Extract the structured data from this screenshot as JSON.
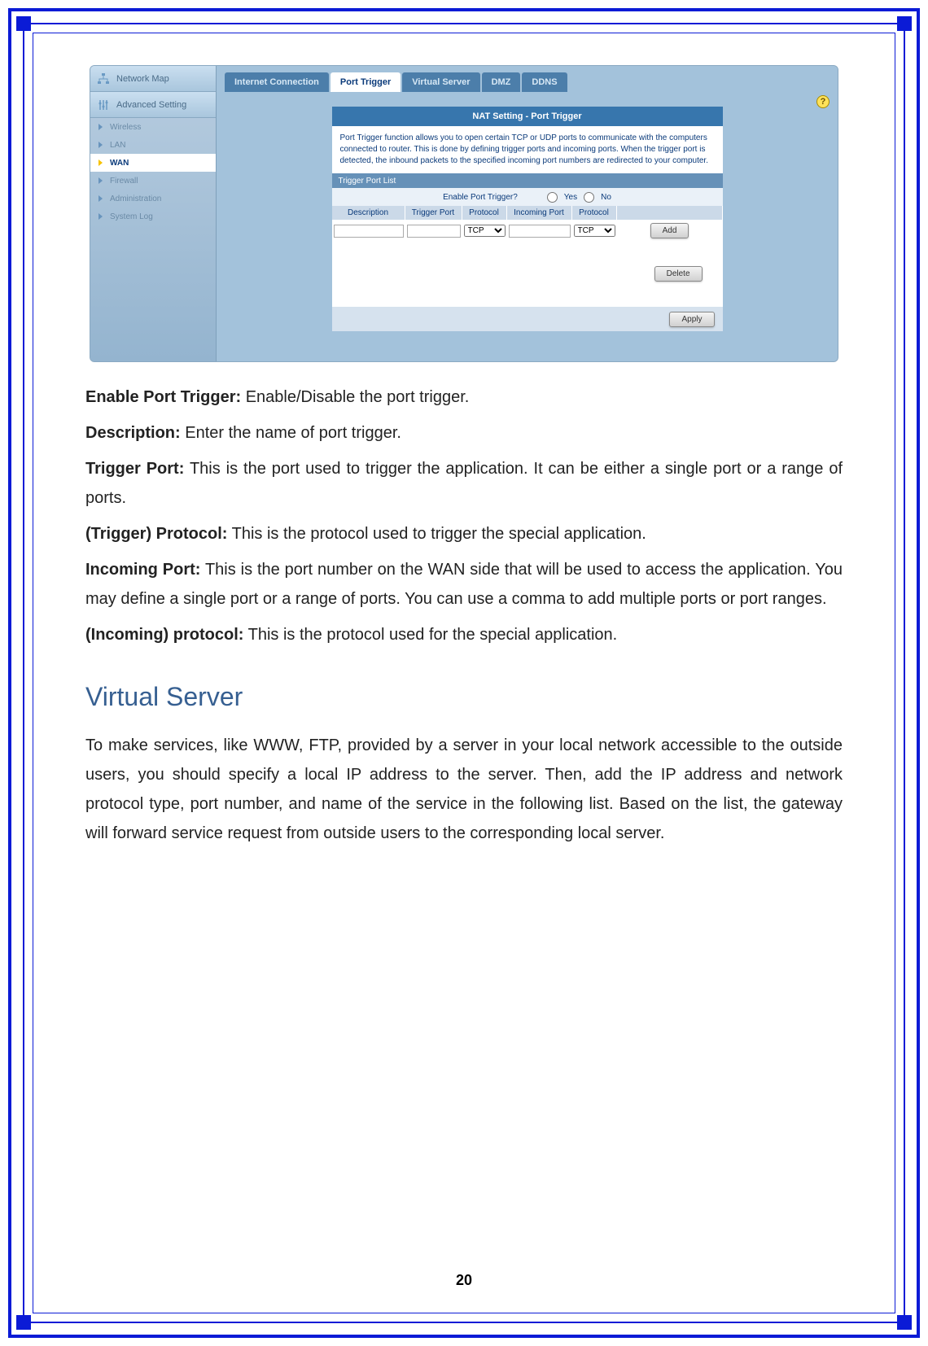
{
  "pageNumber": "20",
  "nav": {
    "networkMap": "Network Map",
    "advancedSetting": "Advanced Setting",
    "items": [
      "Wireless",
      "LAN",
      "WAN",
      "Firewall",
      "Administration",
      "System Log"
    ]
  },
  "tabs": [
    "Internet Connection",
    "Port Trigger",
    "Virtual Server",
    "DMZ",
    "DDNS"
  ],
  "panel": {
    "title": "NAT Setting - Port Trigger",
    "intro": "Port Trigger function allows you to open certain TCP or UDP ports to communicate with the computers connected to router.    This is done by defining trigger ports and incoming ports. When the trigger port is detected, the inbound packets to the specified incoming port numbers are redirected to your computer.",
    "subTitle": "Trigger Port List",
    "enableLabel": "Enable Port Trigger?",
    "yes": "Yes",
    "no": "No",
    "cols": [
      "Description",
      "Trigger Port",
      "Protocol",
      "Incoming Port",
      "Protocol"
    ],
    "protocolOption": "TCP",
    "btnAdd": "Add",
    "btnDelete": "Delete",
    "btnApply": "Apply",
    "help": "?"
  },
  "doc": {
    "p1": {
      "label": "Enable Port Trigger:",
      "text": " Enable/Disable the port trigger."
    },
    "p2": {
      "label": "Description:",
      "text": " Enter the name of port trigger."
    },
    "p3": {
      "label": "Trigger Port:",
      "text": " This is the port used to trigger the application. It can be either a single port or a range of ports."
    },
    "p4": {
      "label": "(Trigger) Protocol:",
      "text": " This is the protocol used to trigger the special application."
    },
    "p5": {
      "label": "Incoming Port:",
      "text": " This is the port number on the WAN side that will be used to access the application. You may define a single port or a range of ports. You can use a comma to add multiple ports or port ranges."
    },
    "p6": {
      "label": "(Incoming) protocol:",
      "text": " This is the protocol used for the special application."
    },
    "heading": "Virtual Server",
    "p7": "To make services, like WWW, FTP, provided by a server in your local network accessible to the outside users, you should specify a local IP address to the server. Then, add the IP address and network protocol type, port number, and name of the service in the following list. Based on the list, the gateway will forward service request from outside users to the corresponding local server."
  }
}
